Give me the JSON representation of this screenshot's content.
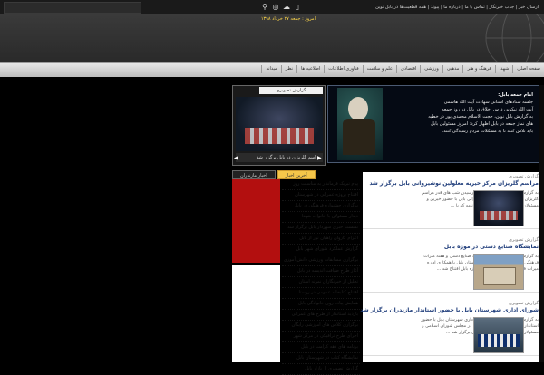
{
  "topbar": {
    "ticker": "ارسال خبر | جذب خبرنگار | تماس با ما | درباره ما | پیوند | همه قطعیت‌ها در بابل نوین",
    "icons": [
      "search-icon",
      "rss-icon",
      "twitter-icon",
      "mobile-icon"
    ]
  },
  "header": {
    "date": "امروز : جمعه ۲۷ خرداد ۱۳۹۸"
  },
  "nav": {
    "items": [
      "صفحه اصلی",
      "شهدا",
      "فرهنگ و هنر",
      "مذهبی",
      "ورزشی",
      "اقتصادی",
      "علم و سلامت",
      "فناوری اطلاعات",
      "اطلاعیه ها",
      "نظر",
      "میدانه"
    ]
  },
  "feature": {
    "title": "امام جمعه بابل:",
    "line1": "جلسه ستادهای استانی شهادت آیت الله هاشمی",
    "line2": "آیت الله نیکویی درس اخلاق در بابل در روز جمعه",
    "line3": "به گزارش بابل نوین، حجت الاسلام محمدی پور در خطبه",
    "line4": "های نماز جمعه در بابل اظهار کرد: امروز مسئولین بابل",
    "line5": "باید تلاش کنند تا به مشکلات مردم رسیدگی کنند."
  },
  "photo": {
    "caption": "گزارش تصویری",
    "footer": "مراسم گلریزان در بابل برگزار شد"
  },
  "tabs": {
    "active": "آخرین اخبار",
    "inactive": "اخبار مازندران"
  },
  "darklist": [
    "پیام تبریک فرماندار به مناسبت روز",
    "افتتاح پروژه عمرانی در شهرستان",
    "برگزاری جشنواره فرهنگی در بابل",
    "دیدار مسئولان با خانواده شهدا",
    "نشست خبری شهردار بابل برگزار شد",
    "اعزام کاروان راهیان نور از بابل",
    "گزارش عملکرد شورای شهر بابل",
    "برگزاری مسابقات ورزشی دانش آموزی",
    "آغاز طرح ضیافت اندیشه در بابل",
    "تجلیل از خبرنگاران نمونه استان",
    "افتتاح کتابخانه عمومی در روستا",
    "همایش پیاده روی خانوادگی بابل",
    "بازدید استاندار از طرح های عمرانی",
    "برگزاری کلاس های آموزشی رایگان",
    "اجرای طرح ترافیکی در مرکز شهر",
    "برنامه های دهه کرامت در بابل",
    "نمایشگاه کتاب در شهرستان بابل",
    "گزارش تصویری از بازار بابل"
  ],
  "news": [
    {
      "kicker": "گزارش تصویری",
      "title": "مراسم گلریزان مرکز خیریه معلولین نوشیروانی بابل برگزار شد",
      "summary": "به گزارش بابل نوین، همزمان با فرا رسیدن شب های قدر مراسم گلریزان مرکز خیریه معلولین نوشیروانی بابل با حضور خیرین و مسئولان این شهر برگزار شد. این برنامه که با ..."
    },
    {
      "kicker": "گزارش تصویری",
      "title": "نمایشگاه صنایع دستی در موزه بابل",
      "summary": "به گزارش بابل نوین، همزمان با هفته صنایع دستی و هفته میراث فرهنگی نمایشگاه صنایع دستی شهرستان بابل با همکاری اداره میراث فرهنگی و صنایع دستی در موزه بابل افتتاح شد ..."
    },
    {
      "kicker": "گزارش تصویری",
      "title": "شورای اداری شهرستان بابل با حضور استاندار مازندران برگزار شد",
      "summary": "به گزارش بابل نوین، جلسه شورای اداری شهرستان بابل با حضور استاندار مازندران، نماینده مردم بابل در مجلس شورای اسلامی و مسئولان این شهر در محل فرمانداری برگزار شد ..."
    }
  ]
}
